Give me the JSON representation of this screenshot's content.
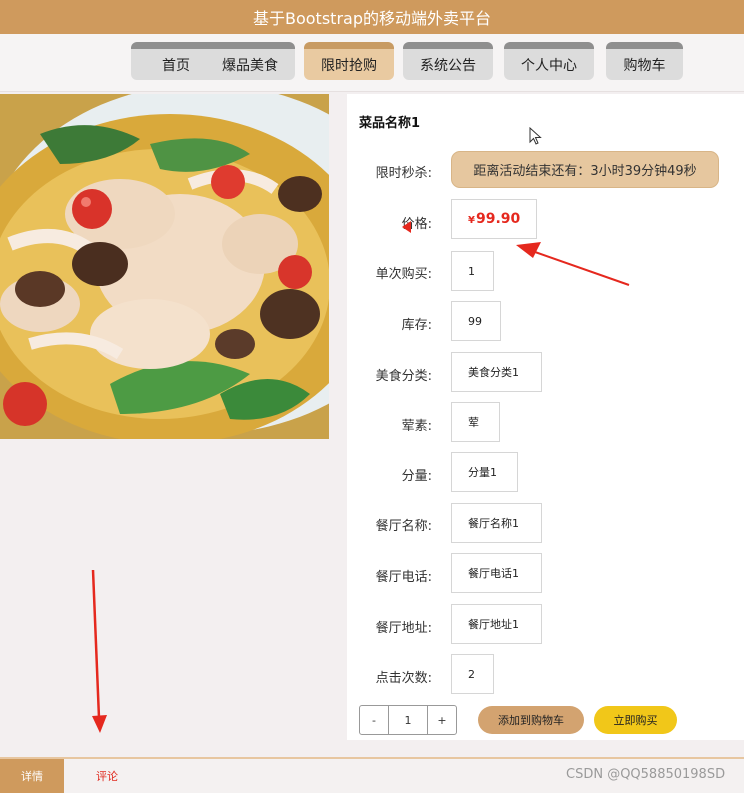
{
  "app": {
    "title": "基于Bootstrap的移动端外卖平台"
  },
  "nav": {
    "items": [
      {
        "label": "首页"
      },
      {
        "label": "爆品美食"
      },
      {
        "label": "限时抢购",
        "active": true
      },
      {
        "label": "系统公告"
      },
      {
        "label": "个人中心"
      },
      {
        "label": "购物车"
      }
    ]
  },
  "dish": {
    "name": "菜品名称1",
    "flash_sale": {
      "label": "限时秒杀:",
      "countdown": "距离活动结束还有：3小时39分钟49秒"
    },
    "price": {
      "label": "价格:",
      "currency": "¥",
      "value": "99.90"
    },
    "fields": [
      {
        "label": "单次购买:",
        "value": "1"
      },
      {
        "label": "库存:",
        "value": "99"
      },
      {
        "label": "美食分类:",
        "value": "美食分类1"
      },
      {
        "label": "荤素:",
        "value": "荤"
      },
      {
        "label": "分量:",
        "value": "分量1"
      },
      {
        "label": "餐厅名称:",
        "value": "餐厅名称1"
      },
      {
        "label": "餐厅电话:",
        "value": "餐厅电话1"
      },
      {
        "label": "餐厅地址:",
        "value": "餐厅地址1"
      },
      {
        "label": "点击次数:",
        "value": "2"
      }
    ]
  },
  "purchase": {
    "minus": "-",
    "quantity": "1",
    "plus": "+",
    "add_to_cart": "添加到购物车",
    "buy_now": "立即购买"
  },
  "bottom_tabs": {
    "detail": "详情",
    "comment": "评论"
  },
  "watermark": "CSDN @QQ58850198SD",
  "colors": {
    "brand": "#cf9a5d",
    "active_tab": "#e9caa1",
    "price": "#e5281e",
    "buy_button": "#f1c719",
    "cart_button": "#d3a370",
    "annotation_arrow": "#e5281e"
  },
  "icons": {
    "cursor": "mouse-pointer-icon"
  }
}
